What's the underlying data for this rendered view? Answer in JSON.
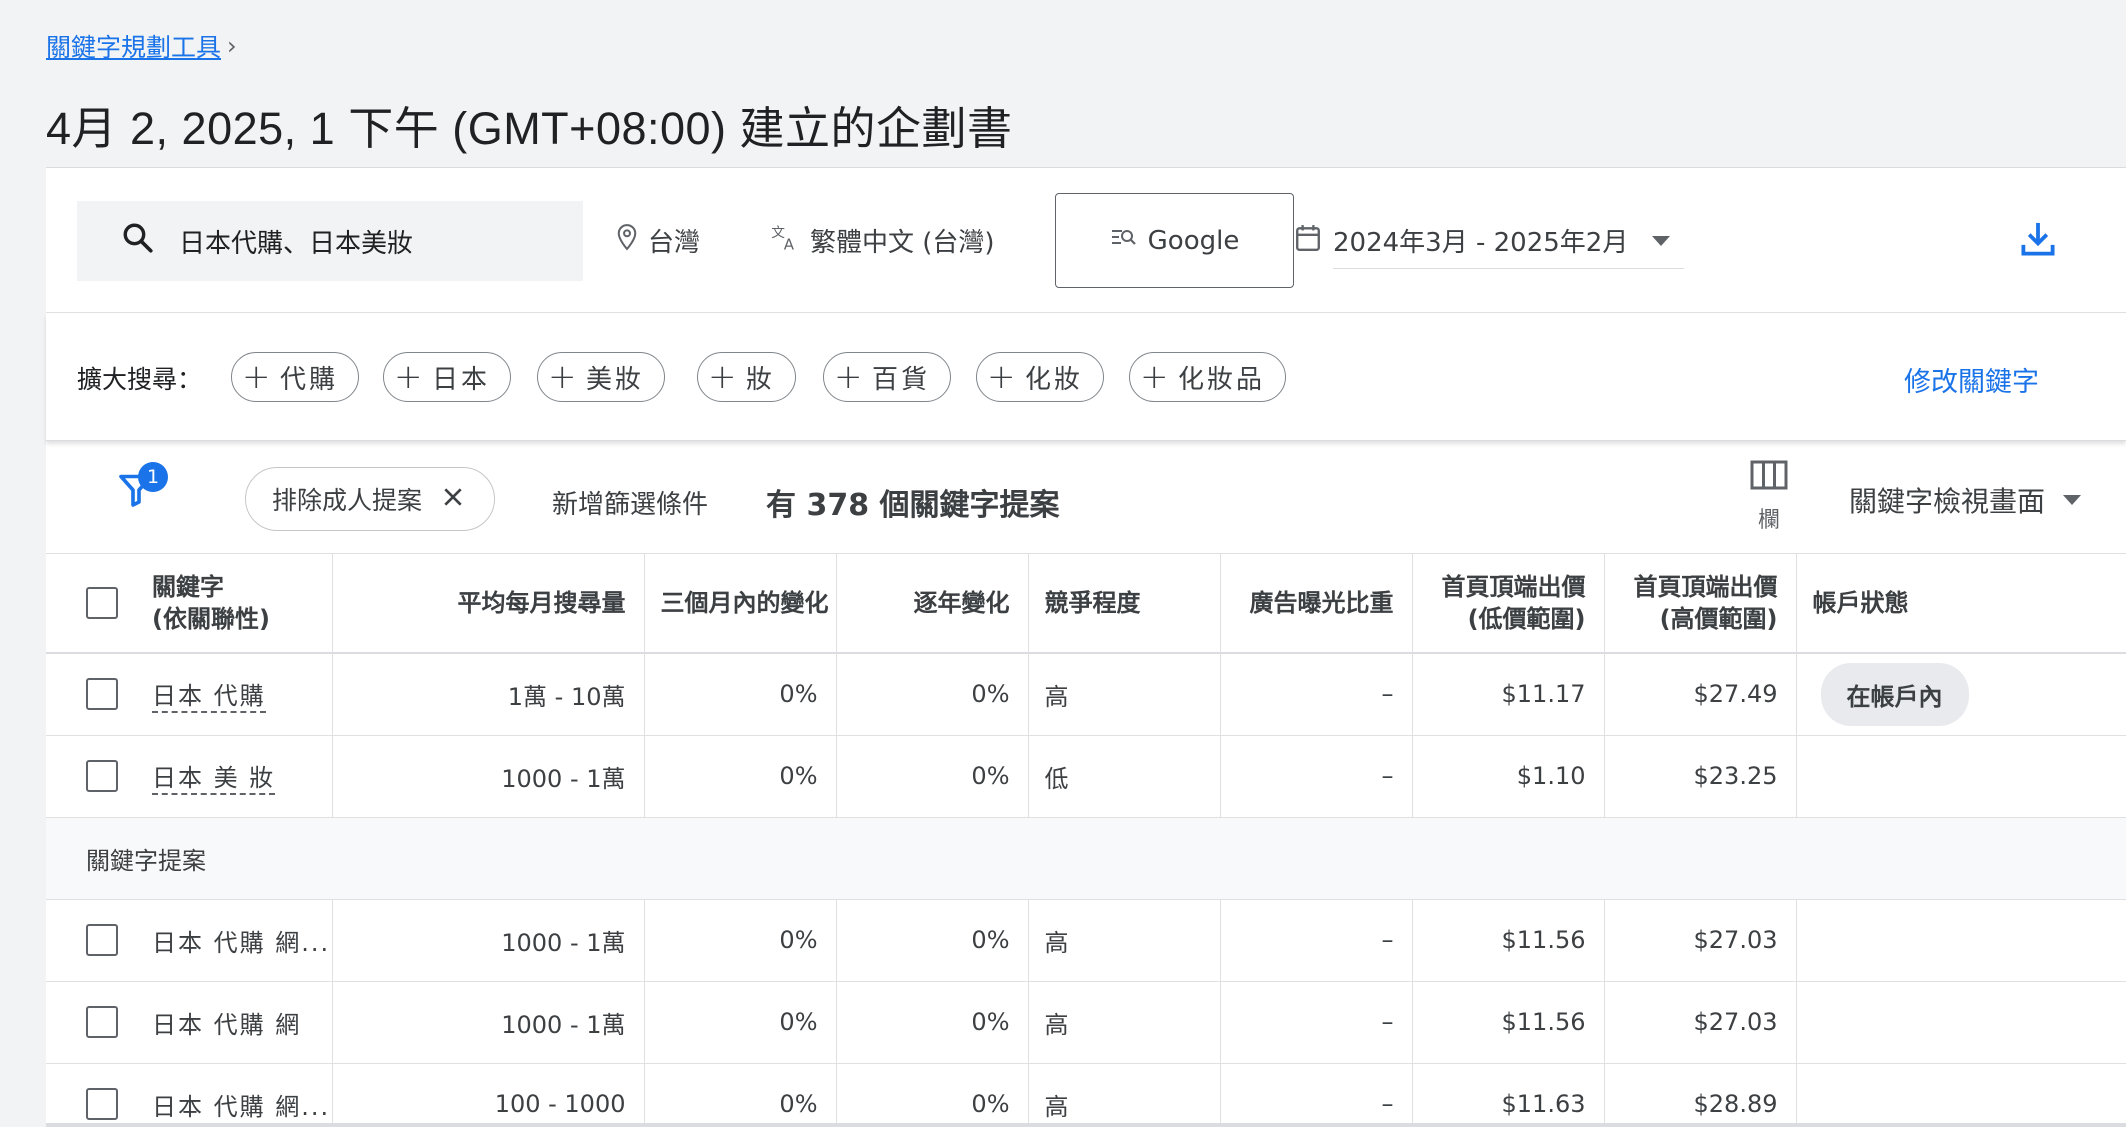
{
  "breadcrumb": {
    "label": "關鍵字規劃工具",
    "chevron": "›"
  },
  "page_title": "4月 2, 2025, 1 下午 (GMT+08:00) 建立的企劃書",
  "searchbar": {
    "query": "日本代購、日本美妝",
    "location": "台灣",
    "language": "繁體中文 (台灣)",
    "network": "Google",
    "date_range": "2024年3月 - 2025年2月"
  },
  "expand": {
    "label": "擴大搜尋：",
    "chips": [
      "代購",
      "日本",
      "美妝",
      "妝",
      "百貨",
      "化妝",
      "化妝品"
    ],
    "edit_label": "修改關鍵字"
  },
  "filters": {
    "badge_count": "1",
    "active_filter": "排除成人提案",
    "add_filter": "新增篩選條件",
    "result_count": "有 378 個關鍵字提案",
    "columns_label": "欄",
    "view_label": "關鍵字檢視畫面"
  },
  "table": {
    "headers": {
      "keyword_line1": "關鍵字",
      "keyword_line2": "(依關聯性)",
      "avg_monthly": "平均每月搜尋量",
      "three_month": "三個月內的變化",
      "yoy": "逐年變化",
      "competition": "競爭程度",
      "impression_share": "廣告曝光比重",
      "top_bid_low_1": "首頁頂端出價",
      "top_bid_low_2": "(低價範圍)",
      "top_bid_high_1": "首頁頂端出價",
      "top_bid_high_2": "(高價範圍)",
      "account_status": "帳戶狀態"
    },
    "provided_rows": [
      {
        "keyword": "日本 代購",
        "avg": "1萬 - 10萬",
        "three_month": "0%",
        "yoy": "0%",
        "competition": "高",
        "share": "–",
        "bid_low": "$11.17",
        "bid_high": "$27.49",
        "status": "在帳戶內"
      },
      {
        "keyword": "日本 美 妝",
        "avg": "1000 - 1萬",
        "three_month": "0%",
        "yoy": "0%",
        "competition": "低",
        "share": "–",
        "bid_low": "$1.10",
        "bid_high": "$23.25",
        "status": ""
      }
    ],
    "section_label": "關鍵字提案",
    "idea_rows": [
      {
        "keyword": "日本 代購 網...",
        "avg": "1000 - 1萬",
        "three_month": "0%",
        "yoy": "0%",
        "competition": "高",
        "share": "–",
        "bid_low": "$11.56",
        "bid_high": "$27.03"
      },
      {
        "keyword": "日本 代購 網",
        "avg": "1000 - 1萬",
        "three_month": "0%",
        "yoy": "0%",
        "competition": "高",
        "share": "–",
        "bid_low": "$11.56",
        "bid_high": "$27.03"
      },
      {
        "keyword": "日本 代購 網...",
        "avg": "100 - 1000",
        "three_month": "0%",
        "yoy": "0%",
        "competition": "高",
        "share": "–",
        "bid_low": "$11.63",
        "bid_high": "$28.89"
      }
    ]
  },
  "colors": {
    "accent": "#1a73e8",
    "background": "#f1f3f4",
    "chip_bg": "#e8eaed"
  },
  "icons": [
    "chevron-right-icon",
    "search-icon",
    "location-pin-icon",
    "translate-icon",
    "search-network-icon",
    "calendar-icon",
    "dropdown-caret-icon",
    "download-icon",
    "plus-icon",
    "filter-icon",
    "close-icon",
    "columns-icon"
  ]
}
